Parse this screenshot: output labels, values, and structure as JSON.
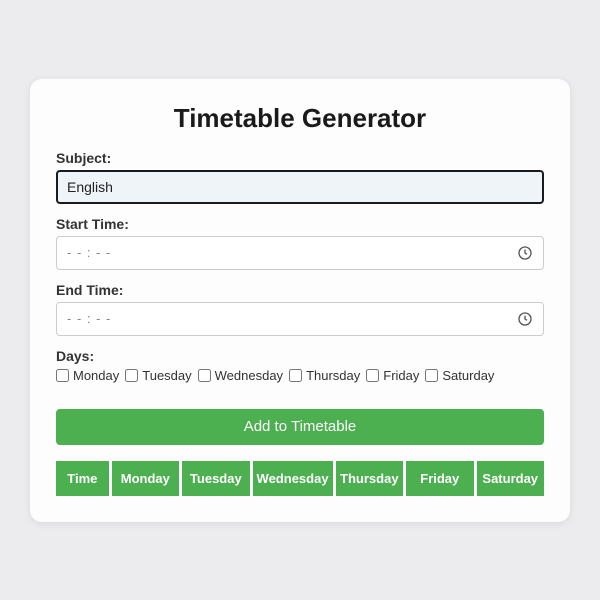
{
  "title": "Timetable Generator",
  "subject": {
    "label": "Subject:",
    "value": "English"
  },
  "start_time": {
    "label": "Start Time:",
    "placeholder": "- - : - -"
  },
  "end_time": {
    "label": "End Time:",
    "placeholder": "- - : - -"
  },
  "days": {
    "label": "Days:",
    "options": [
      "Monday",
      "Tuesday",
      "Wednesday",
      "Thursday",
      "Friday",
      "Saturday"
    ]
  },
  "add_button": "Add to Timetable",
  "table_headers": [
    "Time",
    "Monday",
    "Tuesday",
    "Wednesday",
    "Thursday",
    "Friday",
    "Saturday"
  ]
}
